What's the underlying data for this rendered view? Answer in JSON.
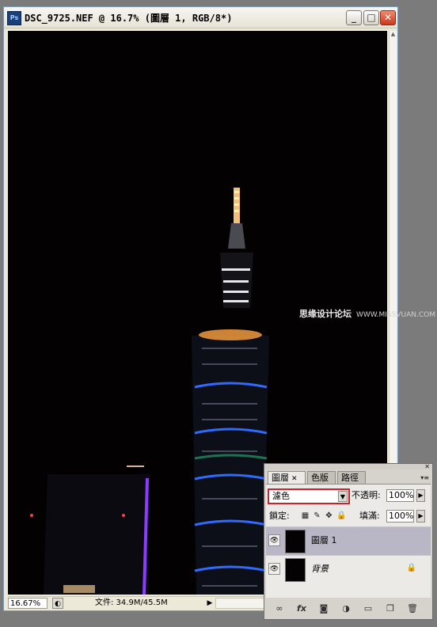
{
  "window": {
    "title": "DSC_9725.NEF @ 16.7% (圖層 1, RGB/8*)",
    "app_icon_label": "Ps",
    "buttons": {
      "minimize": "_",
      "maximize": "□",
      "close": "✕"
    }
  },
  "statusbar": {
    "zoom": "16.67%",
    "doc_info": "文件: 34.9M/45.5M",
    "arrow": "▶"
  },
  "watermark": {
    "brand": "思缘设计论坛",
    "url": "WWW.MISSVUAN.COM"
  },
  "layers_panel": {
    "close_glyph": "✕",
    "menu_glyph": "▾≡",
    "tabs": [
      {
        "label": "圖層",
        "active": true
      },
      {
        "label": "色版",
        "active": false
      },
      {
        "label": "路徑",
        "active": false
      }
    ],
    "blend_mode": "濾色",
    "opacity_label": "不透明:",
    "opacity_value": "100%",
    "lock_label": "鎖定:",
    "fill_label": "填滿:",
    "fill_value": "100%",
    "layers": [
      {
        "name": "圖層 1",
        "visible": true,
        "selected": true,
        "locked": false
      },
      {
        "name": "背景",
        "visible": true,
        "selected": false,
        "locked": true
      }
    ],
    "footer_icons": [
      "link-icon",
      "fx-icon",
      "mask-icon",
      "adjustment-icon",
      "group-icon",
      "new-layer-icon",
      "trash-icon"
    ]
  },
  "colors": {
    "canvas_background": "#030102",
    "blend_highlight": "#c8232c",
    "selected_layer": "#b9b7c6",
    "tower_blue_ring": "#2f6bff",
    "tower_green_ring": "#2fd58a",
    "building_purple_edge": "#8a3cff"
  }
}
